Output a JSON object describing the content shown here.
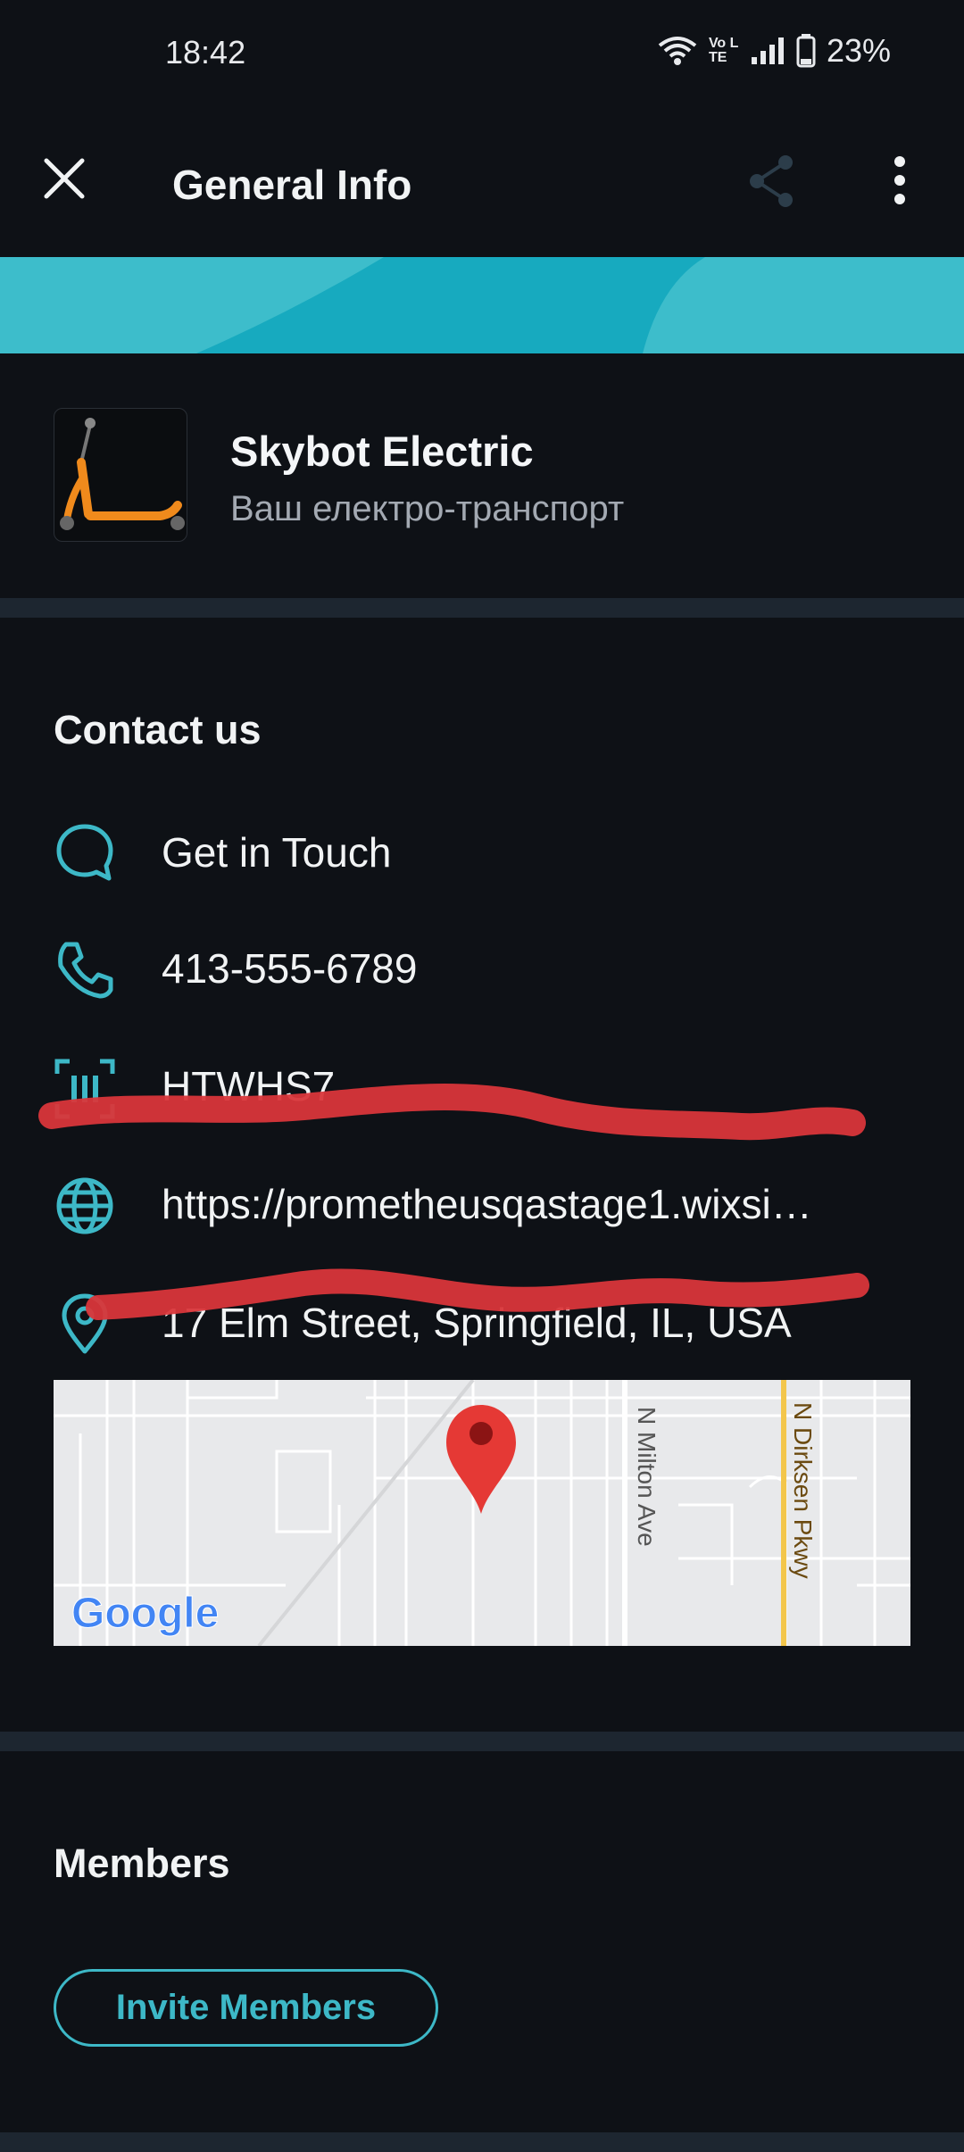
{
  "status_bar": {
    "time": "18:42",
    "volte": "Vo LTE",
    "battery": "23%"
  },
  "app_bar": {
    "title": "General Info",
    "icons": [
      "close-icon",
      "share-icon",
      "more-vertical-icon"
    ]
  },
  "business": {
    "name": "Skybot Electric",
    "tagline": "Ваш електро-транспорт",
    "logo": "scooter-logo"
  },
  "contact": {
    "title": "Contact us",
    "items": [
      {
        "icon": "chat-bubble-icon",
        "text": "Get in Touch"
      },
      {
        "icon": "phone-icon",
        "text": "413-555-6789"
      },
      {
        "icon": "scan-code-icon",
        "text": "HTWHS7"
      },
      {
        "icon": "globe-icon",
        "text": "https://prometheusqastage1.wixsi…"
      },
      {
        "icon": "location-pin-icon",
        "text": "17 Elm Street, Springfield, IL, USA"
      }
    ],
    "map": {
      "streets": [
        "N Milton Ave",
        "N Dirksen Pkwy"
      ],
      "brand": "Google"
    }
  },
  "members": {
    "title": "Members",
    "invite_label": "Invite Members"
  },
  "colors": {
    "background": "#0e1116",
    "accent": "#3db8c7",
    "divider": "#1d2630",
    "scribble": "#d9363a"
  }
}
